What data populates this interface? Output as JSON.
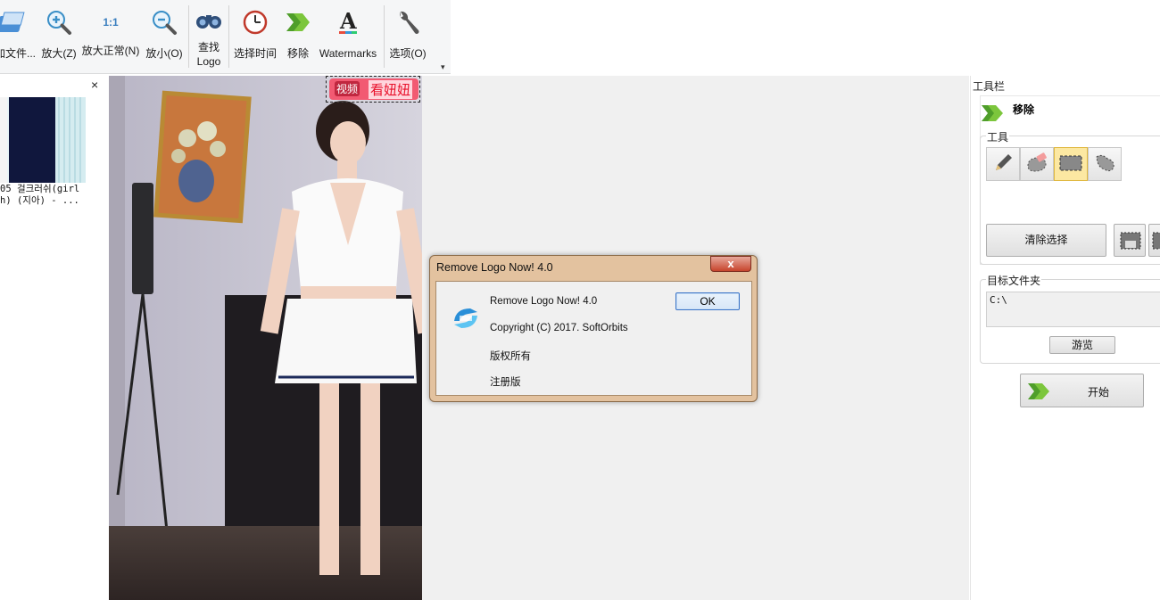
{
  "toolbar": {
    "add_files": "加文件...",
    "zoom_in": "放大(Z)",
    "zoom_normal": "放大正常(N)",
    "zoom_normal_icon_text": "1:1",
    "zoom_out": "放小(O)",
    "find_logo": "查找\nLogo",
    "find_logo_line1": "查找",
    "find_logo_line2": "Logo",
    "select_time": "选择时间",
    "remove": "移除",
    "watermarks": "Watermarks",
    "options": "选项(O)"
  },
  "thumbnails": {
    "caption_line1": "05 걸크러쉬(girl",
    "caption_line2": "h) (지아) - ...",
    "close_glyph": "×"
  },
  "logo_overlay": {
    "badge_text": "视频",
    "text": "看妞妞"
  },
  "right_panel": {
    "title": "工具栏",
    "mode_label": "移除",
    "tools_group_label": "工具",
    "clear_selection": "清除选择",
    "target_folder_label": "目标文件夹",
    "target_folder_value": "C:\\",
    "browse": "游览",
    "start": "开始",
    "tools": [
      "pencil-icon",
      "eraser-icon",
      "rect-select-icon",
      "lasso-icon"
    ],
    "active_tool": "rect-select-icon"
  },
  "dialog": {
    "title": "Remove Logo Now! 4.0",
    "close_glyph": "x",
    "line1": "Remove Logo Now! 4.0",
    "line2": "Copyright (C) 2017. SoftOrbits",
    "line3": "版权所有",
    "line4": "注册版",
    "ok": "OK"
  },
  "colors": {
    "accent_green": "#6bbf2a",
    "dialog_frame": "#e3c29f",
    "active_tool": "#fce8a2"
  }
}
